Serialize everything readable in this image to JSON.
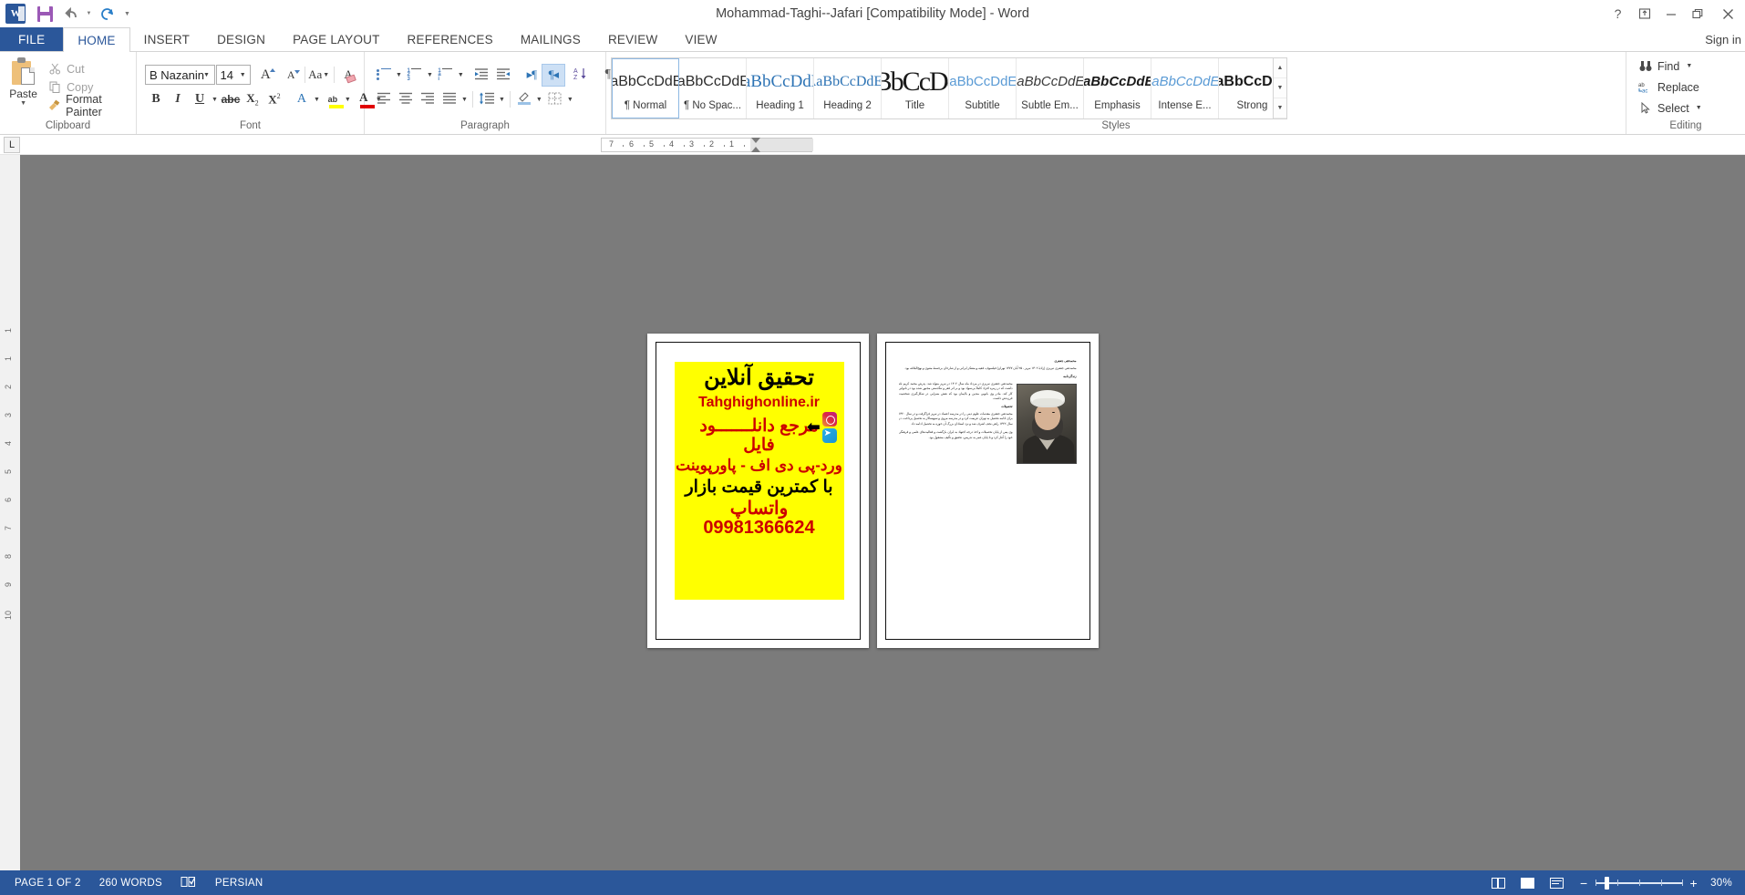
{
  "app": {
    "title": "Mohammad-Taghi--Jafari [Compatibility Mode] - Word",
    "signin": "Sign in"
  },
  "quick_access": {
    "items": [
      {
        "name": "word-logo",
        "label": "W"
      },
      {
        "name": "save-icon",
        "label": ""
      },
      {
        "name": "undo-icon",
        "label": "↺"
      },
      {
        "name": "undo-dropdown",
        "label": "▾"
      },
      {
        "name": "redo-icon",
        "label": "↻"
      },
      {
        "name": "customize-qat-icon",
        "label": "▾"
      }
    ]
  },
  "window_controls": [
    {
      "name": "help-button",
      "glyph": "?"
    },
    {
      "name": "ribbon-display-options-button",
      "glyph": "⬒"
    },
    {
      "name": "minimize-button",
      "glyph": "—"
    },
    {
      "name": "restore-button",
      "glyph": "❐"
    },
    {
      "name": "close-button",
      "glyph": "✕"
    }
  ],
  "tabs": [
    {
      "label": "FILE",
      "active": false
    },
    {
      "label": "HOME",
      "active": true
    },
    {
      "label": "INSERT",
      "active": false
    },
    {
      "label": "DESIGN",
      "active": false
    },
    {
      "label": "PAGE LAYOUT",
      "active": false
    },
    {
      "label": "REFERENCES",
      "active": false
    },
    {
      "label": "MAILINGS",
      "active": false
    },
    {
      "label": "REVIEW",
      "active": false
    },
    {
      "label": "VIEW",
      "active": false
    }
  ],
  "ribbon": {
    "clipboard": {
      "label": "Clipboard",
      "paste": "Paste",
      "cut": "Cut",
      "copy": "Copy",
      "format_painter": "Format Painter"
    },
    "font": {
      "label": "Font",
      "font_name": "B Nazanin",
      "font_size": "14",
      "buttons": [
        {
          "name": "grow-font-button",
          "label": "A"
        },
        {
          "name": "shrink-font-button",
          "label": "A"
        },
        {
          "name": "change-case-button",
          "label": "Aa"
        },
        {
          "name": "clear-formatting-button",
          "label": "A"
        },
        {
          "name": "bold-button",
          "label": "B"
        },
        {
          "name": "italic-button",
          "label": "I"
        },
        {
          "name": "underline-button",
          "label": "U"
        },
        {
          "name": "strikethrough-button",
          "label": "abc"
        },
        {
          "name": "subscript-button",
          "label": "X"
        },
        {
          "name": "superscript-button",
          "label": "X"
        },
        {
          "name": "text-effects-button",
          "label": "A"
        },
        {
          "name": "text-highlight-color-button",
          "label": "ab"
        },
        {
          "name": "font-color-button",
          "label": "A"
        }
      ]
    },
    "paragraph": {
      "label": "Paragraph",
      "buttons": [
        {
          "name": "bullets-button",
          "label": ""
        },
        {
          "name": "numbering-button",
          "label": ""
        },
        {
          "name": "multilevel-list-button",
          "label": ""
        },
        {
          "name": "decrease-indent-button",
          "label": ""
        },
        {
          "name": "increase-indent-button",
          "label": ""
        },
        {
          "name": "ltr-text-direction-button",
          "label": "▸¶"
        },
        {
          "name": "rtl-text-direction-button",
          "label": "¶◂"
        },
        {
          "name": "sort-button",
          "label": "A↓"
        },
        {
          "name": "show-formatting-marks-button",
          "label": "¶"
        },
        {
          "name": "align-left-button",
          "label": ""
        },
        {
          "name": "align-center-button",
          "label": ""
        },
        {
          "name": "align-right-button",
          "label": ""
        },
        {
          "name": "justify-button",
          "label": ""
        },
        {
          "name": "line-spacing-button",
          "label": ""
        },
        {
          "name": "shading-button",
          "label": ""
        },
        {
          "name": "borders-button",
          "label": ""
        }
      ]
    },
    "styles": {
      "label": "Styles",
      "items": [
        {
          "preview": "AaBbCcDdEe",
          "name": "¶ Normal",
          "selected": true
        },
        {
          "preview": "AaBbCcDdEe",
          "name": "¶ No Spac...",
          "selected": false
        },
        {
          "preview": "AaBbCcDdEe",
          "name": "Heading 1",
          "selected": false
        },
        {
          "preview": "AaBbCcDdEe",
          "name": "Heading 2",
          "selected": false
        },
        {
          "preview": "AaBbCcDdEe",
          "name": "Title",
          "selected": false
        },
        {
          "preview": "AaBbCcDdEe",
          "name": "Subtitle",
          "selected": false
        },
        {
          "preview": "AaBbCcDdEe",
          "name": "Subtle Em...",
          "selected": false
        },
        {
          "preview": "AaBbCcDdEe",
          "name": "Emphasis",
          "selected": false
        },
        {
          "preview": "AaBbCcDdEe",
          "name": "Intense E...",
          "selected": false
        },
        {
          "preview": "AaBbCcDdEe",
          "name": "Strong",
          "selected": false
        }
      ]
    },
    "editing": {
      "label": "Editing",
      "find": "Find",
      "replace": "Replace",
      "select": "Select"
    }
  },
  "ruler": {
    "tab_selector": "L",
    "numbers": [
      "7",
      "6",
      "5",
      "4",
      "3",
      "2",
      "1"
    ]
  },
  "document": {
    "page_markers": [
      "1",
      "1",
      "2",
      "3",
      "4",
      "5",
      "6",
      "7",
      "8",
      "9",
      "10"
    ],
    "page1": {
      "flyer": {
        "line1": "تحقیق آنلاین",
        "line2": "Tahghighonline.ir",
        "line3": "مرجع دانلـــــــود",
        "line4": "فایل",
        "line5": "ورد-پی دی اف - پاورپوینت",
        "line6": "با کمترین قیمت بازار",
        "line7": "واتساپ 09981366624",
        "bg_color": "#ffff00",
        "text_color": "#cc0000"
      }
    },
    "page2": {
      "heading1": "محمدتقی جعفری",
      "para1": "محمدتقی جعفری تبریزی (زادهٔ ۱۳۰۲ تبریز - ۲۵ آبان ۱۳۷۷ تهران) فیلسوف، فقیه و متفکر ایرانی و از شارحان برجستهٔ مثنوی و نهج‌البلاغه بود.",
      "heading2": "زندگی‌نامه",
      "para2": "محمدتقی جعفری تبریزی در مرداد ماه سال ۱۳۰۲ در تبریز متولد شد. پدرش محمد کریم نام داشت که در زمره افراد کاملاً بی‌سواد بود و بر اثر فقر و تنگدستی مجبور شده بود در نانوایی کار کند. مادر وی بانویی متدین و باایمان بود که نقش بسزایی در شکل‌گیری شخصیت فرزندش داشت.",
      "heading3": "تحصیلات",
      "para3": "محمدتقی جعفری مقدمات علوم دینی را در مدرسه اعتماد در تبریز فراگرفت و در سال ۱۳۲۰ برای ادامه تحصیل به تهران عزیمت کرد و در مدرسه مروی و سپهسالار به تحصیل پرداخت. در سال ۱۳۲۲ راهی نجف اشرف شد و نزد استادان بزرگ آن حوزه به تحصیل ادامه داد.",
      "para4": "وی پس از پایان تحصیلات و اخذ درجه اجتهاد به ایران بازگشت و فعالیت‌های علمی و فرهنگی خود را آغاز کرد و تا پایان عمر به تدریس، تحقیق و تألیف مشغول بود."
    }
  },
  "status_bar": {
    "page": "PAGE 1 OF 2",
    "words": "260 WORDS",
    "proofing_icon": "spell-check-icon",
    "language": "PERSIAN",
    "views": [
      {
        "name": "read-mode-button"
      },
      {
        "name": "print-layout-button"
      },
      {
        "name": "web-layout-button"
      }
    ],
    "zoom": {
      "minus": "−",
      "plus": "+",
      "level": "30%"
    }
  }
}
